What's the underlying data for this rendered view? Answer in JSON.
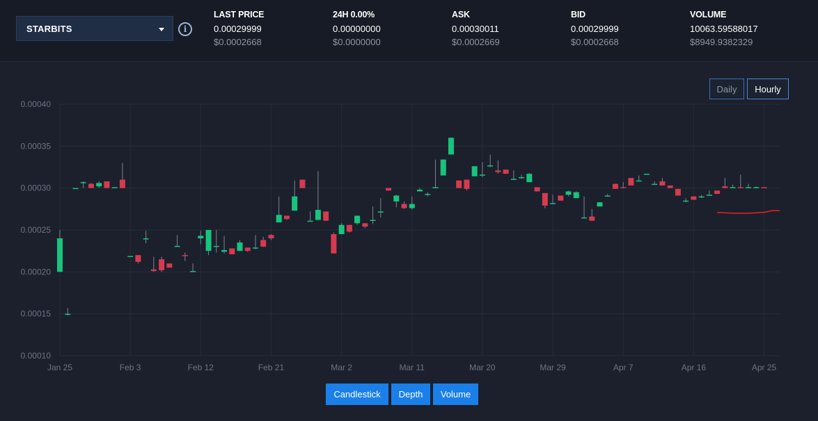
{
  "market_selector": {
    "label": "STARBITS"
  },
  "stats": [
    {
      "label": "LAST PRICE",
      "value": "0.00029999",
      "usd": "$0.0002668"
    },
    {
      "label": "24H 0.00%",
      "value": "0.00000000",
      "usd": "$0.0000000"
    },
    {
      "label": "ASK",
      "value": "0.00030011",
      "usd": "$0.0002669"
    },
    {
      "label": "BID",
      "value": "0.00029999",
      "usd": "$0.0002668"
    },
    {
      "label": "VOLUME",
      "value": "10063.59588017",
      "usd": "$8949.9382329"
    }
  ],
  "range_buttons": {
    "daily": "Daily",
    "hourly": "Hourly",
    "active": "hourly"
  },
  "mode_buttons": {
    "candlestick": "Candlestick",
    "depth": "Depth",
    "volume": "Volume"
  },
  "colors": {
    "up": "#17c47e",
    "down": "#d63a4f",
    "grid": "#262c39",
    "axis_text": "#6c7482",
    "overlay": "#e02020"
  },
  "chart_data": {
    "type": "candlestick",
    "x_axis": "date",
    "x_tick_labels": [
      "Jan 25",
      "Feb 3",
      "Feb 12",
      "Feb 21",
      "Mar 2",
      "Mar 11",
      "Mar 20",
      "Mar 29",
      "Apr 7",
      "Apr 16",
      "Apr 25"
    ],
    "y_tick_labels": [
      "0.00040",
      "0.00035",
      "0.00030",
      "0.00025",
      "0.00020",
      "0.00015",
      "0.00010"
    ],
    "ylim": [
      0.0001,
      0.0004
    ],
    "xlim": [
      "Jan 25",
      "Apr 27"
    ],
    "grid": true,
    "candles": [
      {
        "date": "Jan 25",
        "open": 0.0002,
        "high": 0.00025,
        "low": 0.0002,
        "close": 0.00024
      },
      {
        "date": "Jan 26",
        "open": 0.00015,
        "high": 0.000157,
        "low": 0.000148,
        "close": 0.00015
      },
      {
        "date": "Jan 27",
        "open": 0.0003,
        "high": 0.0003,
        "low": 0.0003,
        "close": 0.0003
      },
      {
        "date": "Jan 28",
        "open": 0.000307,
        "high": 0.000308,
        "low": 0.0003,
        "close": 0.000307
      },
      {
        "date": "Jan 29",
        "open": 0.000305,
        "high": 0.000306,
        "low": 0.0003,
        "close": 0.0003
      },
      {
        "date": "Jan 30",
        "open": 0.000302,
        "high": 0.000308,
        "low": 0.0003,
        "close": 0.000306
      },
      {
        "date": "Jan 31",
        "open": 0.000308,
        "high": 0.000308,
        "low": 0.0003,
        "close": 0.0003
      },
      {
        "date": "Feb 1",
        "open": 0.000301,
        "high": 0.000301,
        "low": 0.0003,
        "close": 0.000301
      },
      {
        "date": "Feb 2",
        "open": 0.00031,
        "high": 0.00033,
        "low": 0.0003,
        "close": 0.0003
      },
      {
        "date": "Feb 3",
        "open": 0.000219,
        "high": 0.000219,
        "low": 0.000219,
        "close": 0.000219
      },
      {
        "date": "Feb 4",
        "open": 0.00022,
        "high": 0.00022,
        "low": 0.00021,
        "close": 0.000212
      },
      {
        "date": "Feb 5",
        "open": 0.000239,
        "high": 0.000249,
        "low": 0.000234,
        "close": 0.00024
      },
      {
        "date": "Feb 6",
        "open": 0.000203,
        "high": 0.000218,
        "low": 0.0002,
        "close": 0.000201
      },
      {
        "date": "Feb 7",
        "open": 0.000215,
        "high": 0.000218,
        "low": 0.0002,
        "close": 0.000202
      },
      {
        "date": "Feb 8",
        "open": 0.00021,
        "high": 0.00021,
        "low": 0.000205,
        "close": 0.000205
      },
      {
        "date": "Feb 9",
        "open": 0.000231,
        "high": 0.000244,
        "low": 0.00023,
        "close": 0.000231
      },
      {
        "date": "Feb 10",
        "open": 0.00022,
        "high": 0.000223,
        "low": 0.000213,
        "close": 0.000219
      },
      {
        "date": "Feb 11",
        "open": 0.000201,
        "high": 0.00021,
        "low": 0.000201,
        "close": 0.000201
      },
      {
        "date": "Feb 12",
        "open": 0.00024,
        "high": 0.000249,
        "low": 0.000233,
        "close": 0.000243
      },
      {
        "date": "Feb 13",
        "open": 0.000225,
        "high": 0.00025,
        "low": 0.00022,
        "close": 0.00025
      },
      {
        "date": "Feb 14",
        "open": 0.000231,
        "high": 0.00025,
        "low": 0.000223,
        "close": 0.000231
      },
      {
        "date": "Feb 15",
        "open": 0.000224,
        "high": 0.000243,
        "low": 0.000222,
        "close": 0.000226
      },
      {
        "date": "Feb 16",
        "open": 0.000228,
        "high": 0.000228,
        "low": 0.000221,
        "close": 0.000221
      },
      {
        "date": "Feb 17",
        "open": 0.000225,
        "high": 0.000238,
        "low": 0.000225,
        "close": 0.000235
      },
      {
        "date": "Feb 18",
        "open": 0.000229,
        "high": 0.000229,
        "low": 0.000224,
        "close": 0.000225
      },
      {
        "date": "Feb 19",
        "open": 0.000229,
        "high": 0.000244,
        "low": 0.000227,
        "close": 0.000229
      },
      {
        "date": "Feb 20",
        "open": 0.000238,
        "high": 0.000242,
        "low": 0.00023,
        "close": 0.00023
      },
      {
        "date": "Feb 21",
        "open": 0.000244,
        "high": 0.000245,
        "low": 0.000238,
        "close": 0.00024
      },
      {
        "date": "Feb 22",
        "open": 0.000259,
        "high": 0.00029,
        "low": 0.000259,
        "close": 0.000268
      },
      {
        "date": "Feb 23",
        "open": 0.000267,
        "high": 0.000267,
        "low": 0.000262,
        "close": 0.000263
      },
      {
        "date": "Feb 24",
        "open": 0.000273,
        "high": 0.000309,
        "low": 0.000273,
        "close": 0.00029
      },
      {
        "date": "Feb 25",
        "open": 0.00031,
        "high": 0.00031,
        "low": 0.0003,
        "close": 0.0003
      },
      {
        "date": "Feb 26",
        "open": 0.000261,
        "high": 0.000272,
        "low": 0.00026,
        "close": 0.000261
      },
      {
        "date": "Feb 27",
        "open": 0.000262,
        "high": 0.00032,
        "low": 0.000262,
        "close": 0.000274
      },
      {
        "date": "Feb 28",
        "open": 0.000272,
        "high": 0.000272,
        "low": 0.000261,
        "close": 0.000261
      },
      {
        "date": "Mar 1",
        "open": 0.000245,
        "high": 0.000247,
        "low": 0.000222,
        "close": 0.000222
      },
      {
        "date": "Mar 2",
        "open": 0.000245,
        "high": 0.000258,
        "low": 0.000245,
        "close": 0.000256
      },
      {
        "date": "Mar 3",
        "open": 0.000256,
        "high": 0.000256,
        "low": 0.000247,
        "close": 0.000248
      },
      {
        "date": "Mar 4",
        "open": 0.000258,
        "high": 0.000267,
        "low": 0.000256,
        "close": 0.000267
      },
      {
        "date": "Mar 5",
        "open": 0.000258,
        "high": 0.000258,
        "low": 0.000252,
        "close": 0.000254
      },
      {
        "date": "Mar 6",
        "open": 0.000262,
        "high": 0.000278,
        "low": 0.000257,
        "close": 0.000262
      },
      {
        "date": "Mar 7",
        "open": 0.000272,
        "high": 0.000288,
        "low": 0.000265,
        "close": 0.000272
      },
      {
        "date": "Mar 8",
        "open": 0.0003,
        "high": 0.0003,
        "low": 0.000297,
        "close": 0.000297
      },
      {
        "date": "Mar 9",
        "open": 0.000284,
        "high": 0.000292,
        "low": 0.000277,
        "close": 0.000291
      },
      {
        "date": "Mar 10",
        "open": 0.000281,
        "high": 0.000284,
        "low": 0.000275,
        "close": 0.000276
      },
      {
        "date": "Mar 11",
        "open": 0.000276,
        "high": 0.00029,
        "low": 0.000274,
        "close": 0.000281
      },
      {
        "date": "Mar 12",
        "open": 0.000296,
        "high": 0.0003,
        "low": 0.000296,
        "close": 0.000298
      },
      {
        "date": "Mar 13",
        "open": 0.000293,
        "high": 0.000295,
        "low": 0.00029,
        "close": 0.000293
      },
      {
        "date": "Mar 14",
        "open": 0.000301,
        "high": 0.000334,
        "low": 0.0003,
        "close": 0.000301
      },
      {
        "date": "Mar 15",
        "open": 0.000315,
        "high": 0.000334,
        "low": 0.000315,
        "close": 0.000334
      },
      {
        "date": "Mar 16",
        "open": 0.00034,
        "high": 0.00036,
        "low": 0.00034,
        "close": 0.00036
      },
      {
        "date": "Mar 17",
        "open": 0.000309,
        "high": 0.000309,
        "low": 0.0003,
        "close": 0.0003
      },
      {
        "date": "Mar 18",
        "open": 0.00031,
        "high": 0.00031,
        "low": 0.000297,
        "close": 0.000299
      },
      {
        "date": "Mar 19",
        "open": 0.000314,
        "high": 0.000326,
        "low": 0.000314,
        "close": 0.000326
      },
      {
        "date": "Mar 20",
        "open": 0.000316,
        "high": 0.000331,
        "low": 0.000313,
        "close": 0.000316
      },
      {
        "date": "Mar 21",
        "open": 0.000327,
        "high": 0.00034,
        "low": 0.000325,
        "close": 0.000327
      },
      {
        "date": "Mar 22",
        "open": 0.000321,
        "high": 0.000333,
        "low": 0.000317,
        "close": 0.000319
      },
      {
        "date": "Mar 23",
        "open": 0.000322,
        "high": 0.000322,
        "low": 0.000317,
        "close": 0.000317
      },
      {
        "date": "Mar 24",
        "open": 0.000311,
        "high": 0.000321,
        "low": 0.00031,
        "close": 0.000311
      },
      {
        "date": "Mar 25",
        "open": 0.000313,
        "high": 0.000316,
        "low": 0.000311,
        "close": 0.000313
      },
      {
        "date": "Mar 26",
        "open": 0.000307,
        "high": 0.000318,
        "low": 0.000307,
        "close": 0.000317
      },
      {
        "date": "Mar 27",
        "open": 0.000301,
        "high": 0.000301,
        "low": 0.000296,
        "close": 0.000296
      },
      {
        "date": "Mar 28",
        "open": 0.000294,
        "high": 0.000294,
        "low": 0.000276,
        "close": 0.000279
      },
      {
        "date": "Mar 29",
        "open": 0.000282,
        "high": 0.000292,
        "low": 0.000282,
        "close": 0.000282
      },
      {
        "date": "Mar 30",
        "open": 0.000291,
        "high": 0.000291,
        "low": 0.000285,
        "close": 0.000285
      },
      {
        "date": "Mar 31",
        "open": 0.000292,
        "high": 0.000297,
        "low": 0.00029,
        "close": 0.000296
      },
      {
        "date": "Apr 1",
        "open": 0.000288,
        "high": 0.000296,
        "low": 0.000288,
        "close": 0.000295
      },
      {
        "date": "Apr 2",
        "open": 0.000265,
        "high": 0.00029,
        "low": 0.000265,
        "close": 0.000265
      },
      {
        "date": "Apr 3",
        "open": 0.000266,
        "high": 0.000275,
        "low": 0.000261,
        "close": 0.000261
      },
      {
        "date": "Apr 4",
        "open": 0.000278,
        "high": 0.000283,
        "low": 0.000278,
        "close": 0.000283
      },
      {
        "date": "Apr 5",
        "open": 0.00029,
        "high": 0.000293,
        "low": 0.00029,
        "close": 0.000291
      },
      {
        "date": "Apr 6",
        "open": 0.000305,
        "high": 0.000305,
        "low": 0.000299,
        "close": 0.000299
      },
      {
        "date": "Apr 7",
        "open": 0.000301,
        "high": 0.000307,
        "low": 0.0003,
        "close": 0.0003
      },
      {
        "date": "Apr 8",
        "open": 0.000312,
        "high": 0.000312,
        "low": 0.000303,
        "close": 0.000303
      },
      {
        "date": "Apr 9",
        "open": 0.000309,
        "high": 0.000315,
        "low": 0.000309,
        "close": 0.000309
      },
      {
        "date": "Apr 10",
        "open": 0.000317,
        "high": 0.000317,
        "low": 0.000317,
        "close": 0.000317
      },
      {
        "date": "Apr 11",
        "open": 0.000305,
        "high": 0.000308,
        "low": 0.000305,
        "close": 0.000305
      },
      {
        "date": "Apr 12",
        "open": 0.000308,
        "high": 0.000312,
        "low": 0.000303,
        "close": 0.000303
      },
      {
        "date": "Apr 13",
        "open": 0.000303,
        "high": 0.000303,
        "low": 0.0003,
        "close": 0.0003
      },
      {
        "date": "Apr 14",
        "open": 0.000299,
        "high": 0.000299,
        "low": 0.000291,
        "close": 0.000291
      },
      {
        "date": "Apr 15",
        "open": 0.000285,
        "high": 0.000288,
        "low": 0.000283,
        "close": 0.000285
      },
      {
        "date": "Apr 16",
        "open": 0.00029,
        "high": 0.00029,
        "low": 0.000286,
        "close": 0.000286
      },
      {
        "date": "Apr 17",
        "open": 0.00029,
        "high": 0.000292,
        "low": 0.000288,
        "close": 0.00029
      },
      {
        "date": "Apr 18",
        "open": 0.000292,
        "high": 0.000297,
        "low": 0.000291,
        "close": 0.000292
      },
      {
        "date": "Apr 19",
        "open": 0.000297,
        "high": 0.000297,
        "low": 0.000293,
        "close": 0.000293
      },
      {
        "date": "Apr 20",
        "open": 0.000302,
        "high": 0.000312,
        "low": 0.0003,
        "close": 0.0003
      },
      {
        "date": "Apr 21",
        "open": 0.000301,
        "high": 0.000304,
        "low": 0.0003,
        "close": 0.000301
      },
      {
        "date": "Apr 22",
        "open": 0.000301,
        "high": 0.000316,
        "low": 0.0003,
        "close": 0.0003
      },
      {
        "date": "Apr 23",
        "open": 0.000301,
        "high": 0.000305,
        "low": 0.0003,
        "close": 0.000301
      },
      {
        "date": "Apr 24",
        "open": 0.000301,
        "high": 0.000302,
        "low": 0.0003,
        "close": 0.000301
      },
      {
        "date": "Apr 25",
        "open": 0.000301,
        "high": 0.000301,
        "low": 0.0003,
        "close": 0.0003
      }
    ],
    "overlay_line": {
      "color": "#e02020",
      "points": [
        {
          "date": "Apr 19",
          "value": 0.000271
        },
        {
          "date": "Apr 21",
          "value": 0.00027
        },
        {
          "date": "Apr 23",
          "value": 0.00027
        },
        {
          "date": "Apr 25",
          "value": 0.000271
        },
        {
          "date": "Apr 26",
          "value": 0.000273
        },
        {
          "date": "Apr 27",
          "value": 0.000273
        }
      ]
    }
  }
}
